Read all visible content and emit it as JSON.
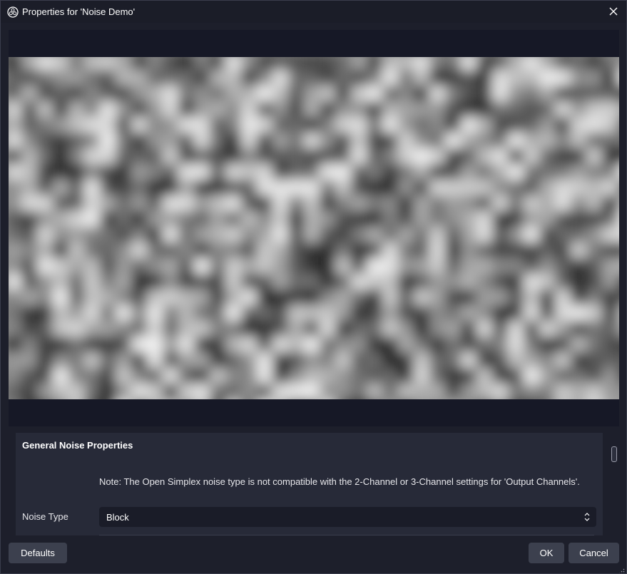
{
  "window": {
    "title": "Properties for 'Noise Demo'",
    "app_icon": "obs-logo-icon",
    "close_icon": "close-icon"
  },
  "preview": {
    "description_icon": "noise-preview-image"
  },
  "properties": {
    "group_title": "General Noise Properties",
    "note": "Note: The Open Simplex noise type is not compatible with the 2-Channel or 3-Channel settings for 'Output Channels'.",
    "noise_type": {
      "label": "Noise Type",
      "value": "Block"
    }
  },
  "buttons": {
    "defaults": "Defaults",
    "ok": "OK",
    "cancel": "Cancel"
  },
  "colors": {
    "background": "#1d1f2b",
    "panel": "#272a38",
    "button": "#3c404e",
    "input": "#1a1c28",
    "preview_bg": "#161826"
  }
}
